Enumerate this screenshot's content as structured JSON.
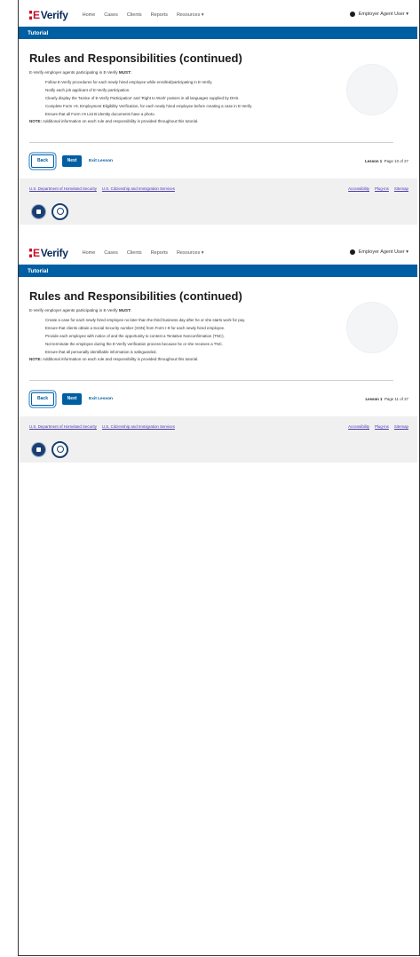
{
  "pages": [
    {
      "logo": {
        "e": "E",
        "verify": "Verify"
      },
      "nav": {
        "home": "Home",
        "cases": "Cases",
        "clients": "Clients",
        "reports": "Reports",
        "resources": "Resources ▾",
        "user": "Employer Agent User ▾"
      },
      "banner": "Tutorial",
      "title": "Rules and Responsibilities (continued)",
      "intro_prefix": "E-Verify employer agents participating in E-Verify ",
      "intro_bold": "MUST:",
      "rules": [
        "Follow E-Verify procedures for each newly hired employee while enrolled/participating in E-Verify.",
        "Notify each job applicant of E-Verify participation.",
        "Clearly display the 'Notice of E-Verify Participation' and 'Right to Work' posters in all languages supplied by DHS.",
        "Complete Form I-9, Employment Eligibility Verification, for each newly hired employee before creating a case in E-Verify.",
        "Ensure that all Form I-9 List B identity documents have a photo."
      ],
      "note_bold": "NOTE:",
      "note_text": " Additional information on each rule and responsibility is provided throughout this tutorial.",
      "buttons": {
        "back": "Back",
        "next": "Next",
        "exit": "Exit Lesson"
      },
      "lesson": "Lesson 1",
      "page_label": "Page 10 of 27",
      "footer": {
        "dhs": "U.S. Department of Homeland Security",
        "uscis": "U.S. Citizenship and Immigration Services",
        "accessibility": "Accessibility",
        "plugins": "Plug-ins",
        "sitemap": "Sitemap"
      }
    },
    {
      "logo": {
        "e": "E",
        "verify": "Verify"
      },
      "nav": {
        "home": "Home",
        "cases": "Cases",
        "clients": "Clients",
        "reports": "Reports",
        "resources": "Resources ▾",
        "user": "Employer Agent User ▾"
      },
      "banner": "Tutorial",
      "title": "Rules and Responsibilities (continued)",
      "intro_prefix": "E-Verify employer agents participating in E-Verify ",
      "intro_bold": "MUST:",
      "rules": [
        "Create a case for each newly hired employee no later than the third business day after he or she starts work for pay.",
        "Ensure that clients obtain a Social Security number (SSN) from Form I-9 for each newly hired employee.",
        "Provide each employee with notice of and the opportunity to contest a Tentative Nonconfirmation (TNC).",
        "Not terminate the employee during the E-Verify verification process because he or she receives a TNC.",
        "Ensure that all personally identifiable information is safeguarded."
      ],
      "note_bold": "NOTE:",
      "note_text": " Additional information on each rule and responsibility is provided throughout this tutorial.",
      "buttons": {
        "back": "Back",
        "next": "Next",
        "exit": "Exit Lesson"
      },
      "lesson": "Lesson 1",
      "page_label": "Page 11 of 27",
      "footer": {
        "dhs": "U.S. Department of Homeland Security",
        "uscis": "U.S. Citizenship and Immigration Services",
        "accessibility": "Accessibility",
        "plugins": "Plug-ins",
        "sitemap": "Sitemap"
      }
    }
  ]
}
